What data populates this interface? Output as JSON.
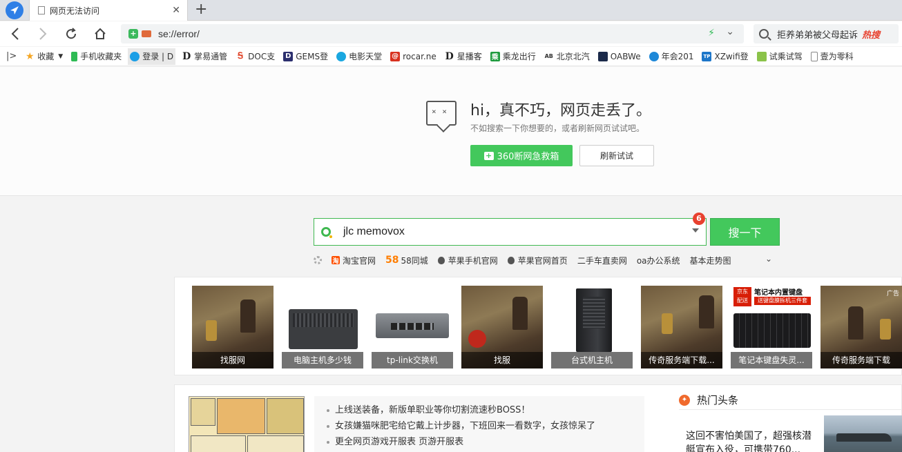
{
  "tab": {
    "title": "网页无法访问"
  },
  "address_bar": {
    "url": "se://error/"
  },
  "top_search": {
    "query": "拒养弟弟被父母起诉",
    "hot_label": "热搜"
  },
  "bookmarks": [
    {
      "label": "收藏",
      "icon": "star-icon"
    },
    {
      "label": "手机收藏夹",
      "icon": "phone-icon"
    },
    {
      "label": "登录 | D",
      "icon": "cloud-icon"
    },
    {
      "label": "掌易通管",
      "icon": "d-icon"
    },
    {
      "label": "DOC支",
      "icon": "doc-icon"
    },
    {
      "label": "GEMS登",
      "icon": "d-icon"
    },
    {
      "label": "电影天堂",
      "icon": "shield-icon"
    },
    {
      "label": "rocar.ne",
      "icon": "at-icon"
    },
    {
      "label": "星播客",
      "icon": "d-icon"
    },
    {
      "label": "乘龙出行",
      "icon": "green-icon"
    },
    {
      "label": "北京北汽",
      "icon": "brand-icon"
    },
    {
      "label": "OABWe",
      "icon": "app-icon"
    },
    {
      "label": "年会201",
      "icon": "globe-icon"
    },
    {
      "label": "XZwifi登",
      "icon": "tp-icon"
    },
    {
      "label": "试乘试驾",
      "icon": "image-icon"
    },
    {
      "label": "壹为零科",
      "icon": "page-icon"
    }
  ],
  "error": {
    "face": "× ×",
    "title": "hi，真不巧，网页走丢了。",
    "subtitle": "不如搜索一下你想要的，或者刷新网页试试吧。",
    "rescue_button": "360断网急救箱",
    "retry_button": "刷新试试"
  },
  "search": {
    "query": "jlc memovox",
    "badge": "6",
    "button": "搜一下"
  },
  "quick_links": [
    {
      "label": "淘宝官网",
      "icon": "taobao-icon",
      "icon_text": "淘",
      "color": "#ff5000"
    },
    {
      "label": "58同城",
      "icon": "58-icon",
      "icon_text": "58",
      "color": "#ff7e00"
    },
    {
      "label": "苹果手机官网",
      "icon": "apple-icon",
      "icon_text": "",
      "color": "#555555"
    },
    {
      "label": "苹果官网首页",
      "icon": "apple-icon",
      "icon_text": "",
      "color": "#555555"
    },
    {
      "label": "二手车直卖网",
      "icon": "",
      "icon_text": "",
      "color": ""
    },
    {
      "label": "oa办公系统",
      "icon": "",
      "icon_text": "",
      "color": ""
    },
    {
      "label": "基本走势图",
      "icon": "",
      "icon_text": "",
      "color": ""
    }
  ],
  "image_cards": [
    {
      "caption": "找服网",
      "kind": "game"
    },
    {
      "caption": "电脑主机多少钱",
      "kind": "pc"
    },
    {
      "caption": "tp-link交换机",
      "kind": "switch"
    },
    {
      "caption": "找服",
      "kind": "game"
    },
    {
      "caption": "台式机主机",
      "kind": "tower"
    },
    {
      "caption": "传奇服务端下载...",
      "kind": "game"
    },
    {
      "caption": "笔记本键盘失灵...",
      "kind": "keyboard"
    },
    {
      "caption": "传奇服务端下载",
      "kind": "game"
    }
  ],
  "keyboard_ad": {
    "brand": "京东\n配送",
    "title": "笔记本内置键盘",
    "subtitle": "送键盘膜拆机三件套"
  },
  "ad_label": "广告",
  "news": {
    "items": [
      "上线送装备，新版单职业等你切割流速秒BOSS！",
      "女孩嫌猫咪肥宅给它戴上计步器，下班回来一看数字，女孩惊呆了",
      "更全网页游戏开服表 页游开服表"
    ],
    "hot_title": "热门头条",
    "hot_text": "这回不害怕美国了，超强核潜艇宣布入役，可携带760..."
  },
  "colors": {
    "accent_green": "#43c85c",
    "alert_red": "#e8412f"
  }
}
